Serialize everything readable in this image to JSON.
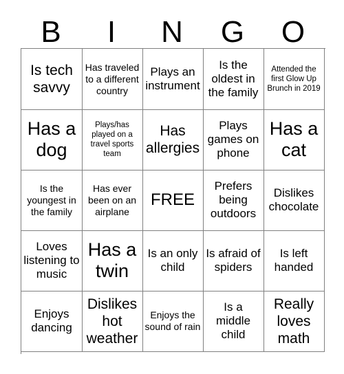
{
  "card": {
    "title_letters": [
      "B",
      "I",
      "N",
      "G",
      "O"
    ],
    "grid_colors": {
      "border": "#808080",
      "text": "#000000",
      "background": "#ffffff"
    },
    "rows": [
      [
        {
          "text": "Is tech savvy",
          "size": "lg"
        },
        {
          "text": "Has traveled to a different country",
          "size": "sm"
        },
        {
          "text": "Plays an instrument",
          "size": "md"
        },
        {
          "text": "Is the oldest in the family",
          "size": "md"
        },
        {
          "text": "Attended the first Glow Up Brunch in 2019",
          "size": "xs"
        }
      ],
      [
        {
          "text": "Has a dog",
          "size": "xl"
        },
        {
          "text": "Plays/has played on a travel sports team",
          "size": "xs"
        },
        {
          "text": "Has allergies",
          "size": "lg"
        },
        {
          "text": "Plays games on phone",
          "size": "md"
        },
        {
          "text": "Has a cat",
          "size": "xl"
        }
      ],
      [
        {
          "text": "Is the youngest in the family",
          "size": "sm"
        },
        {
          "text": "Has ever been on an airplane",
          "size": "sm"
        },
        {
          "text": "FREE",
          "size": "free"
        },
        {
          "text": "Prefers being outdoors",
          "size": "md"
        },
        {
          "text": "Dislikes chocolate",
          "size": "md"
        }
      ],
      [
        {
          "text": "Loves listening to music",
          "size": "md"
        },
        {
          "text": "Has a twin",
          "size": "xl"
        },
        {
          "text": "Is an only child",
          "size": "md"
        },
        {
          "text": "Is afraid of spiders",
          "size": "md"
        },
        {
          "text": "Is left handed",
          "size": "md"
        }
      ],
      [
        {
          "text": "Enjoys dancing",
          "size": "md"
        },
        {
          "text": "Dislikes hot weather",
          "size": "lg"
        },
        {
          "text": "Enjoys the sound of rain",
          "size": "sm"
        },
        {
          "text": "Is a middle child",
          "size": "md"
        },
        {
          "text": "Really loves math",
          "size": "lg"
        }
      ]
    ]
  }
}
